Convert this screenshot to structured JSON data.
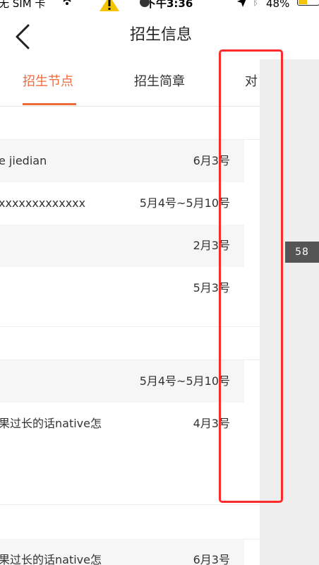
{
  "status_bar": {
    "carrier": "无 SIM 卡",
    "time": "下午3:36",
    "battery": "48%",
    "colors": {
      "battery_fill": "#f5c400",
      "warning": "#f5c400"
    },
    "icons": [
      "wifi-icon",
      "warning-icon",
      "location-arrow-icon",
      "bluetooth-icon",
      "battery-icon"
    ]
  },
  "nav": {
    "title": "招生信息",
    "back_icon": "chevron-left-icon"
  },
  "tabs": [
    {
      "label": "招生节点",
      "active": true
    },
    {
      "label": "招生简章",
      "active": false
    },
    {
      "label": "对",
      "active": false
    }
  ],
  "accent_color": "#f06a3a",
  "list": {
    "groups": [
      {
        "rows": [
          {
            "name": "e jiedian",
            "date": "6月3号"
          },
          {
            "name": "xxxxxxxxxxxxx",
            "date": "5月4号~5月10号"
          },
          {
            "name": "",
            "date": "2月3号"
          },
          {
            "name": "",
            "date": "5月3号"
          }
        ]
      },
      {
        "rows": [
          {
            "name": "",
            "date": "5月4号~5月10号"
          },
          {
            "name": "果过长的话native怎",
            "date": "4月3号"
          }
        ]
      },
      {
        "rows": [
          {
            "name": "果过长的话native怎",
            "date": "6月3号"
          }
        ]
      }
    ]
  },
  "page_badge": "58"
}
